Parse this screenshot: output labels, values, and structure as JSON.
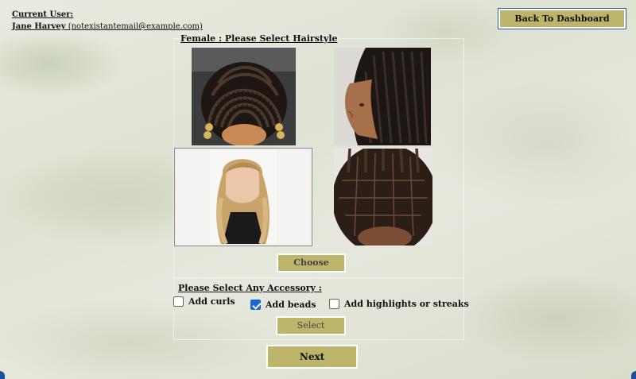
{
  "user": {
    "label": "Current User:",
    "name": "Jane Harvey",
    "email": "(notexistantemail@example.com)"
  },
  "header": {
    "back_button_label": "Back To Dashboard"
  },
  "hairstyle_panel": {
    "title": "Female : Please Select Hairstyle",
    "images": [
      {
        "name": "cornrows-top-view",
        "selected": false
      },
      {
        "name": "box-braids-side-profile",
        "selected": false
      },
      {
        "name": "long-blonde-layered-hair",
        "selected": true
      },
      {
        "name": "knotless-braids-parting",
        "selected": false
      }
    ],
    "choose_button_label": "Choose"
  },
  "accessories": {
    "title": "Please Select Any Accessory :",
    "options": [
      {
        "label": "Add curls",
        "checked": false
      },
      {
        "label": "Add beads",
        "checked": true
      },
      {
        "label": "Add highlights or streaks",
        "checked": false
      }
    ],
    "select_button_label": "Select"
  },
  "footer": {
    "next_button_label": "Next"
  },
  "colors": {
    "button_bg": "#bdb56b",
    "checkbox_checked": "#1a66d2",
    "focus_outline": "#2a5f9e"
  }
}
